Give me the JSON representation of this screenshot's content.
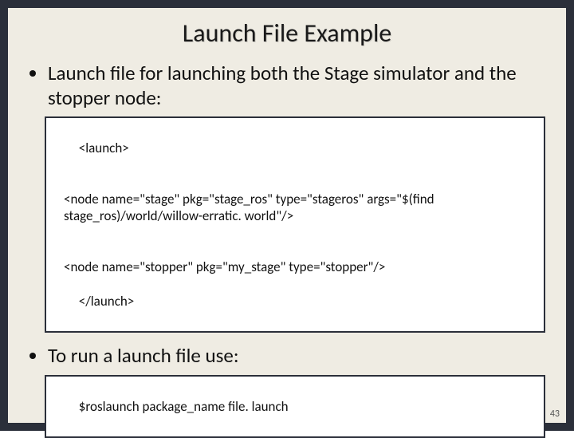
{
  "title": "Launch File Example",
  "bullet1": "Launch file for launching both the Stage simulator and the stopper node:",
  "code1": {
    "l1": "<launch>",
    "l2": "<node name=\"stage\" pkg=\"stage_ros\" type=\"stageros\" args=\"$(find stage_ros)/world/willow-erratic. world\"/>",
    "l3": "<node name=\"stopper\" pkg=\"my_stage\" type=\"stopper\"/>",
    "l4": "</launch>"
  },
  "bullet2": "To run a launch file use:",
  "code2": "$roslaunch package_name file. launch",
  "page_number": "43"
}
